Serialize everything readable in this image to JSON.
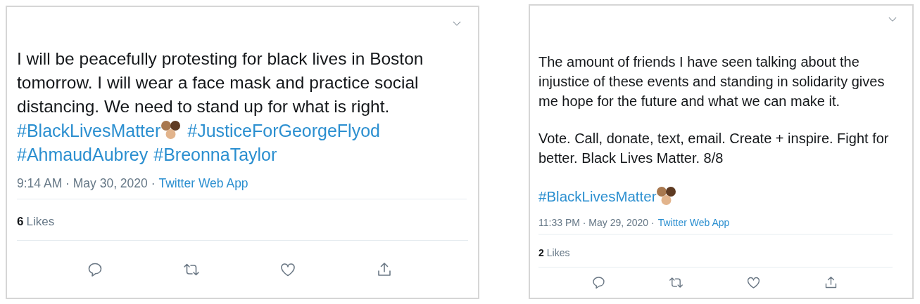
{
  "tweets": [
    {
      "paragraphs": [
        "I will be peacefully protesting for black lives in Boston tomorrow. I will wear a face mask and practice social distancing. We need to stand up for what is right."
      ],
      "hashtag_lines": [
        [
          {
            "kind": "hashtag",
            "text": "#BlackLivesMatter"
          },
          {
            "kind": "emoji"
          },
          {
            "kind": "hashtag",
            "text": "#JusticeForGeorgeFlyod"
          }
        ],
        [
          {
            "kind": "hashtag",
            "text": "#AhmaudAubrey"
          },
          {
            "kind": "hashtag",
            "text": "#BreonnaTaylor"
          }
        ]
      ],
      "time": "9:14 AM · May 30, 2020 ·",
      "source": "Twitter Web App",
      "likes_count": "6",
      "likes_label": "Likes"
    },
    {
      "paragraphs": [
        "The amount of friends I have seen talking about the injustice of these events and standing in solidarity gives me hope for the future and what we can make it.",
        "Vote. Call, donate, text, email. Create + inspire. Fight for better. Black Lives Matter. 8/8"
      ],
      "hashtag_lines": [
        [
          {
            "kind": "hashtag",
            "text": "#BlackLivesMatter"
          },
          {
            "kind": "emoji"
          }
        ]
      ],
      "time": "11:33 PM · May 29, 2020 ·",
      "source": "Twitter Web App",
      "likes_count": "2",
      "likes_label": "Likes"
    }
  ]
}
